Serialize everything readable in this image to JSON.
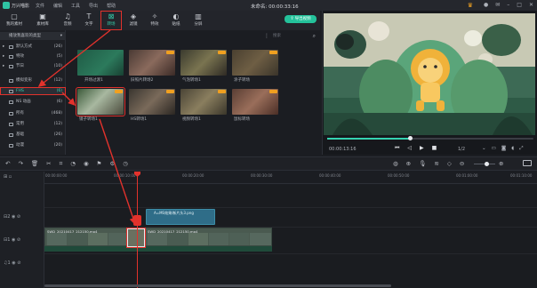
{
  "app": {
    "name": "万兴喵影",
    "menu": [
      "文件",
      "编辑",
      "工具",
      "导出",
      "帮助"
    ],
    "document_title": "未命名: 00:00:33:16"
  },
  "toolbar": {
    "tools": [
      {
        "label": "我的素材",
        "icon": "folder-icon"
      },
      {
        "label": "素材库",
        "icon": "library-icon"
      },
      {
        "label": "音频",
        "icon": "music-icon"
      },
      {
        "label": "文字",
        "icon": "text-icon"
      },
      {
        "label": "转场",
        "icon": "transition-icon",
        "active": true
      },
      {
        "label": "滤镜",
        "icon": "filter-icon"
      },
      {
        "label": "特效",
        "icon": "effect-icon"
      },
      {
        "label": "贴纸",
        "icon": "sticker-icon"
      },
      {
        "label": "分屏",
        "icon": "split-icon"
      }
    ]
  },
  "sidebar": {
    "header": "播放我喜欢的类型",
    "items": [
      {
        "label": "默认方式",
        "count": "(26)"
      },
      {
        "label": "特效",
        "count": "(5)"
      },
      {
        "label": "节日",
        "count": "(10)"
      },
      {
        "label": "模拟变形",
        "count": "(12)"
      },
      {
        "label": "FHS",
        "count": "(6)",
        "selected": true
      },
      {
        "label": "NS 动画",
        "count": "(6)"
      },
      {
        "label": "所有",
        "count": "(468)"
      },
      {
        "label": "常用",
        "count": "(12)"
      },
      {
        "label": "基础",
        "count": "(26)"
      },
      {
        "label": "动漫",
        "count": "(20)"
      }
    ]
  },
  "media": {
    "search_placeholder": "搜索",
    "thumbnails": [
      {
        "label": "开场过渡1"
      },
      {
        "label": "旧照片转场2"
      },
      {
        "label": "气泡转场1"
      },
      {
        "label": "涂子转场"
      },
      {
        "label": "镜子转场1",
        "selected": true
      },
      {
        "label": "HS转场1"
      },
      {
        "label": "视频转场1"
      },
      {
        "label": "鼠标转场"
      }
    ]
  },
  "preview": {
    "export_label": "导出视频",
    "timecode": "00:00:13:16",
    "ratio": "1/2",
    "progress": 0.4
  },
  "timeline": {
    "ruler_ticks": [
      "00:00:00:00",
      "00:00:10:00",
      "00:00:20:00",
      "00:00:30:00",
      "00:00:40:00",
      "00:00:50:00",
      "00:01:00:00",
      "00:01:10:00"
    ],
    "text_clip_label": "A=MS效果/新片头3.png",
    "video_clips": [
      {
        "label": "SWD_20210417_212150.mp4"
      },
      {
        "label": "SWD_20210417_212150.mp4"
      }
    ]
  },
  "colors": {
    "accent": "#35d3b0",
    "annotation": "#e2322c",
    "export": "#24c29b"
  }
}
